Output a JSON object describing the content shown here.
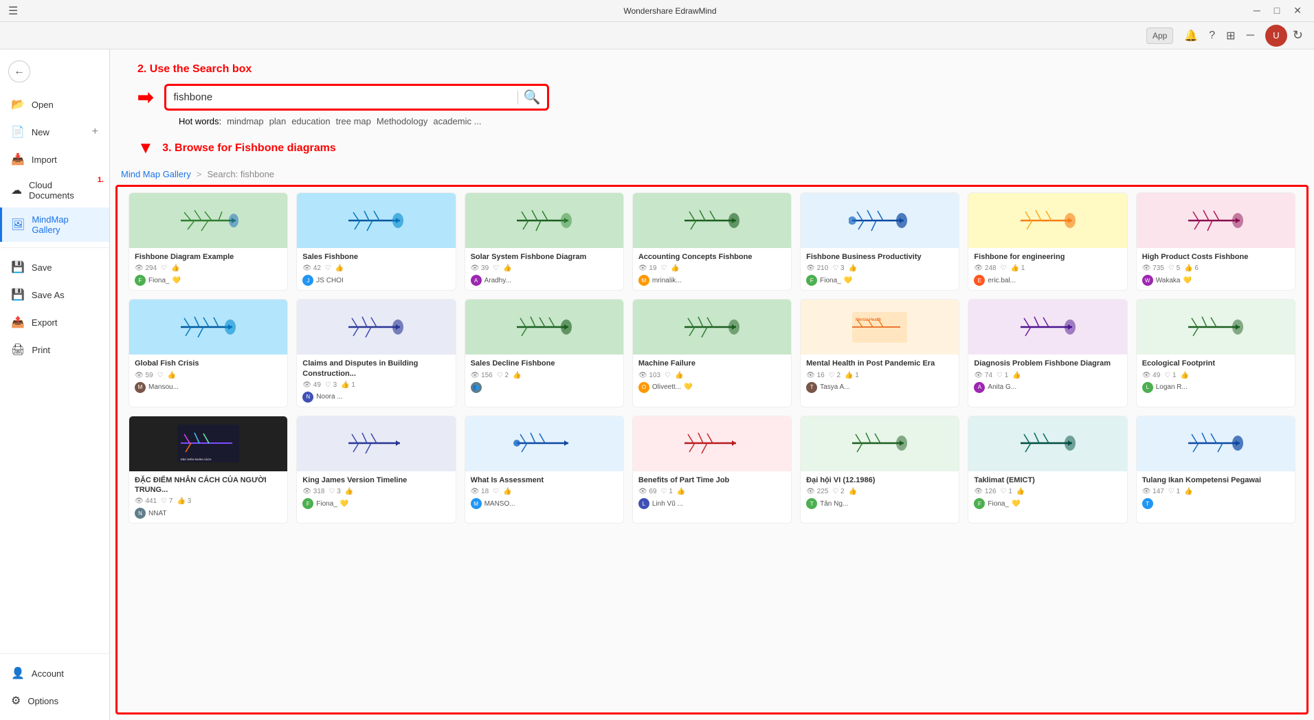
{
  "titleBar": {
    "title": "Wondershare EdrawMind",
    "minBtn": "─",
    "maxBtn": "□",
    "closeBtn": "✕"
  },
  "topToolbar": {
    "appBtn": "App",
    "notifIcon": "🔔",
    "helpIcon": "?",
    "gridIcon": "⊞",
    "minimizeIcon": "─"
  },
  "sidebar": {
    "backLabel": "←",
    "items": [
      {
        "id": "open",
        "label": "Open",
        "icon": "📂"
      },
      {
        "id": "new",
        "label": "New",
        "icon": "📄",
        "hasPlus": true
      },
      {
        "id": "import",
        "label": "Import",
        "icon": "📥"
      },
      {
        "id": "cloud",
        "label": "Cloud Documents",
        "icon": "☁",
        "badge": "1."
      },
      {
        "id": "mindmap-gallery",
        "label": "MindMap Gallery",
        "icon": "🖼",
        "active": true
      },
      {
        "id": "save",
        "label": "Save",
        "icon": "💾"
      },
      {
        "id": "save-as",
        "label": "Save As",
        "icon": "💾"
      },
      {
        "id": "export",
        "label": "Export",
        "icon": "📤"
      },
      {
        "id": "print",
        "label": "Print",
        "icon": "🖨"
      }
    ],
    "bottomItems": [
      {
        "id": "account",
        "label": "Account",
        "icon": "👤"
      },
      {
        "id": "options",
        "label": "Options",
        "icon": "⚙"
      }
    ]
  },
  "annotation": {
    "step1": "1.",
    "step2": "2. Use the Search box",
    "step3": "3. Browse for Fishbone diagrams"
  },
  "search": {
    "value": "fishbone",
    "placeholder": "fishbone",
    "hotWordsLabel": "Hot words:",
    "hotWords": [
      "mindmap",
      "plan",
      "education",
      "tree map",
      "Methodology",
      "academic ..."
    ]
  },
  "breadcrumb": {
    "gallery": "Mind Map Gallery",
    "separator": ">",
    "current": "Search: fishbone"
  },
  "gallery": {
    "cards": [
      {
        "id": 1,
        "title": "Fishbone Diagram Example",
        "views": "294",
        "likes": "",
        "thumbColor": "#c8e6c9",
        "author": "Fiona_",
        "authorColor": "#4caf50",
        "verified": true
      },
      {
        "id": 2,
        "title": "Sales Fishbone",
        "views": "42",
        "likes": "",
        "thumbColor": "#b3e5fc",
        "author": "JS CHOI",
        "authorColor": "#2196f3"
      },
      {
        "id": 3,
        "title": "Solar System Fishbone Diagram",
        "views": "39",
        "likes": "",
        "thumbColor": "#c8e6c9",
        "author": "Aradhy...",
        "authorColor": "#9c27b0"
      },
      {
        "id": 4,
        "title": "Accounting Concepts Fishbone",
        "views": "19",
        "likes": "",
        "thumbColor": "#c8e6c9",
        "author": "mrinalik...",
        "authorColor": "#ff9800"
      },
      {
        "id": 5,
        "title": "Fishbone Business Productivity",
        "views": "210",
        "likes": "3",
        "thumbColor": "#e3f2fd",
        "author": "Fiona_",
        "authorColor": "#4caf50",
        "verified": true
      },
      {
        "id": 6,
        "title": "Fishbone for engineering",
        "views": "248",
        "likes": "1",
        "thumbColor": "#fff9c4",
        "author": "eric.bal...",
        "authorColor": "#ff5722"
      },
      {
        "id": 7,
        "title": "High Product Costs Fishbone",
        "views": "735",
        "likes": "6",
        "thumbColor": "#fce4ec",
        "author": "Wakaka",
        "authorColor": "#9c27b0",
        "verified": true
      },
      {
        "id": 8,
        "title": "Global Fish Crisis",
        "views": "59",
        "likes": "",
        "thumbColor": "#b3e5fc",
        "author": "Mansou...",
        "authorColor": "#795548"
      },
      {
        "id": 9,
        "title": "Claims and Disputes in Building Construction...",
        "views": "49",
        "likes": "1",
        "thumbColor": "#e8eaf6",
        "author": "Noora ...",
        "authorColor": "#3f51b5"
      },
      {
        "id": 10,
        "title": "Sales Decline Fishbone",
        "views": "156",
        "likes": "2",
        "thumbColor": "#c8e6c9",
        "author": "👥",
        "authorColor": "#607d8b"
      },
      {
        "id": 11,
        "title": "Machine Failure",
        "views": "103",
        "likes": "",
        "thumbColor": "#c8e6c9",
        "author": "Oliveett...",
        "authorColor": "#ff9800",
        "verified": true
      },
      {
        "id": 12,
        "title": "Mental Health in Post Pandemic Era",
        "views": "16",
        "likes": "2",
        "thumbColor": "#fff3e0",
        "author": "Tasya A...",
        "authorColor": "#795548"
      },
      {
        "id": 13,
        "title": "Diagnosis Problem Fishbone Diagram",
        "views": "74",
        "likes": "1",
        "thumbColor": "#f3e5f5",
        "author": "Anita G...",
        "authorColor": "#9c27b0"
      },
      {
        "id": 14,
        "title": "Ecological Footprint",
        "views": "49",
        "likes": "1",
        "thumbColor": "#e8f5e9",
        "author": "Logan R...",
        "authorColor": "#4caf50"
      },
      {
        "id": 15,
        "title": "ĐẶC ĐIỂM NHÂN CÁCH CỦA NGƯỜI TRUNG...",
        "views": "441",
        "likes": "3",
        "thumbColor": "#212121",
        "textColor": "#fff",
        "author": "NNAT",
        "authorColor": "#607d8b"
      },
      {
        "id": 16,
        "title": "King James Version Timeline",
        "views": "318",
        "likes": "3",
        "thumbColor": "#e8eaf6",
        "author": "Fiona_",
        "authorColor": "#4caf50",
        "verified": true
      },
      {
        "id": 17,
        "title": "What Is Assessment",
        "views": "18",
        "likes": "",
        "thumbColor": "#e3f2fd",
        "author": "MANSO...",
        "authorColor": "#2196f3"
      },
      {
        "id": 18,
        "title": "Benefits of Part Time Job",
        "views": "69",
        "likes": "1",
        "thumbColor": "#ffebee",
        "author": "Linh Vũ ...",
        "authorColor": "#3f51b5"
      },
      {
        "id": 19,
        "title": "Đại hội VI (12.1986)",
        "views": "225",
        "likes": "2",
        "thumbColor": "#e8f5e9",
        "author": "Tân Ng...",
        "authorColor": "#4caf50"
      },
      {
        "id": 20,
        "title": "Taklimat (EMICT)",
        "views": "126",
        "likes": "1",
        "thumbColor": "#e8f5e9",
        "author": "Fiona_",
        "authorColor": "#4caf50",
        "verified": true
      },
      {
        "id": 21,
        "title": "Tulang Ikan Kompetensi Pegawai",
        "views": "147",
        "likes": "1",
        "thumbColor": "#e3f2fd",
        "author": "",
        "authorColor": "#2196f3"
      }
    ]
  }
}
